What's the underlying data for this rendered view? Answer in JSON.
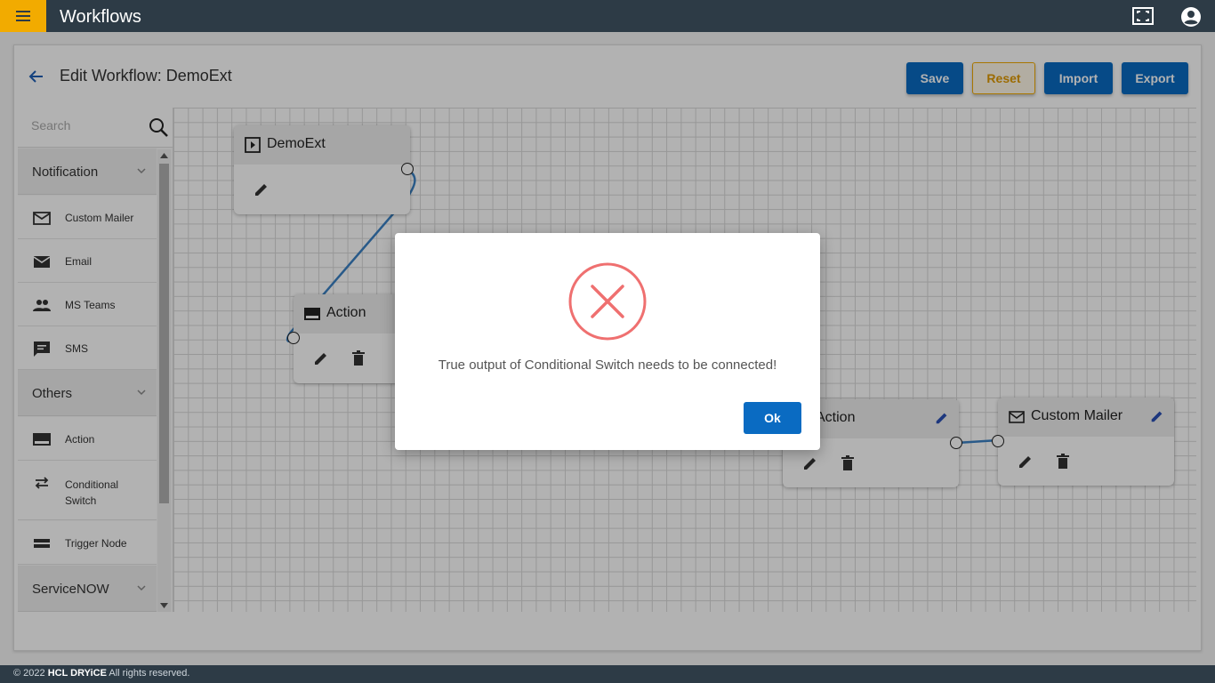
{
  "header": {
    "app_title": "Workflows",
    "icons": {
      "menu": "hamburger-icon",
      "fullscreen": "fullscreen-icon",
      "account": "account-circle-icon"
    }
  },
  "page": {
    "title": "Edit Workflow: DemoExt",
    "buttons": {
      "save": "Save",
      "reset": "Reset",
      "import": "Import",
      "export": "Export"
    }
  },
  "palette": {
    "search_placeholder": "Search",
    "sections": [
      {
        "label": "Notification",
        "items": [
          {
            "label": "Custom Mailer",
            "icon": "mail-outline-icon"
          },
          {
            "label": "Email",
            "icon": "mail-icon"
          },
          {
            "label": "MS Teams",
            "icon": "people-icon"
          },
          {
            "label": "SMS",
            "icon": "message-icon"
          }
        ]
      },
      {
        "label": "Others",
        "items": [
          {
            "label": "Action",
            "icon": "action-icon"
          },
          {
            "label": "Conditional Switch",
            "icon": "swap-icon"
          },
          {
            "label": "Trigger Node",
            "icon": "trigger-icon"
          }
        ]
      },
      {
        "label": "ServiceNOW",
        "items": []
      }
    ]
  },
  "canvas": {
    "nodes": [
      {
        "id": "demoext",
        "label": "DemoExt"
      },
      {
        "id": "action1",
        "label": "Action"
      },
      {
        "id": "action2",
        "label": "Action"
      },
      {
        "id": "custommailer",
        "label": "Custom Mailer"
      }
    ]
  },
  "dialog": {
    "icon": "error-circle-icon",
    "message": "True output of Conditional Switch needs to be connected!",
    "ok_label": "Ok"
  },
  "footer": {
    "prefix": "© 2022 ",
    "brand": "HCL DRYiCE",
    "suffix": " All rights reserved."
  },
  "colors": {
    "accent": "#f2ab00",
    "primary": "#0a6bc2",
    "topbar": "#2d3b46",
    "error": "#ef7070",
    "wire": "#3b82c4"
  }
}
